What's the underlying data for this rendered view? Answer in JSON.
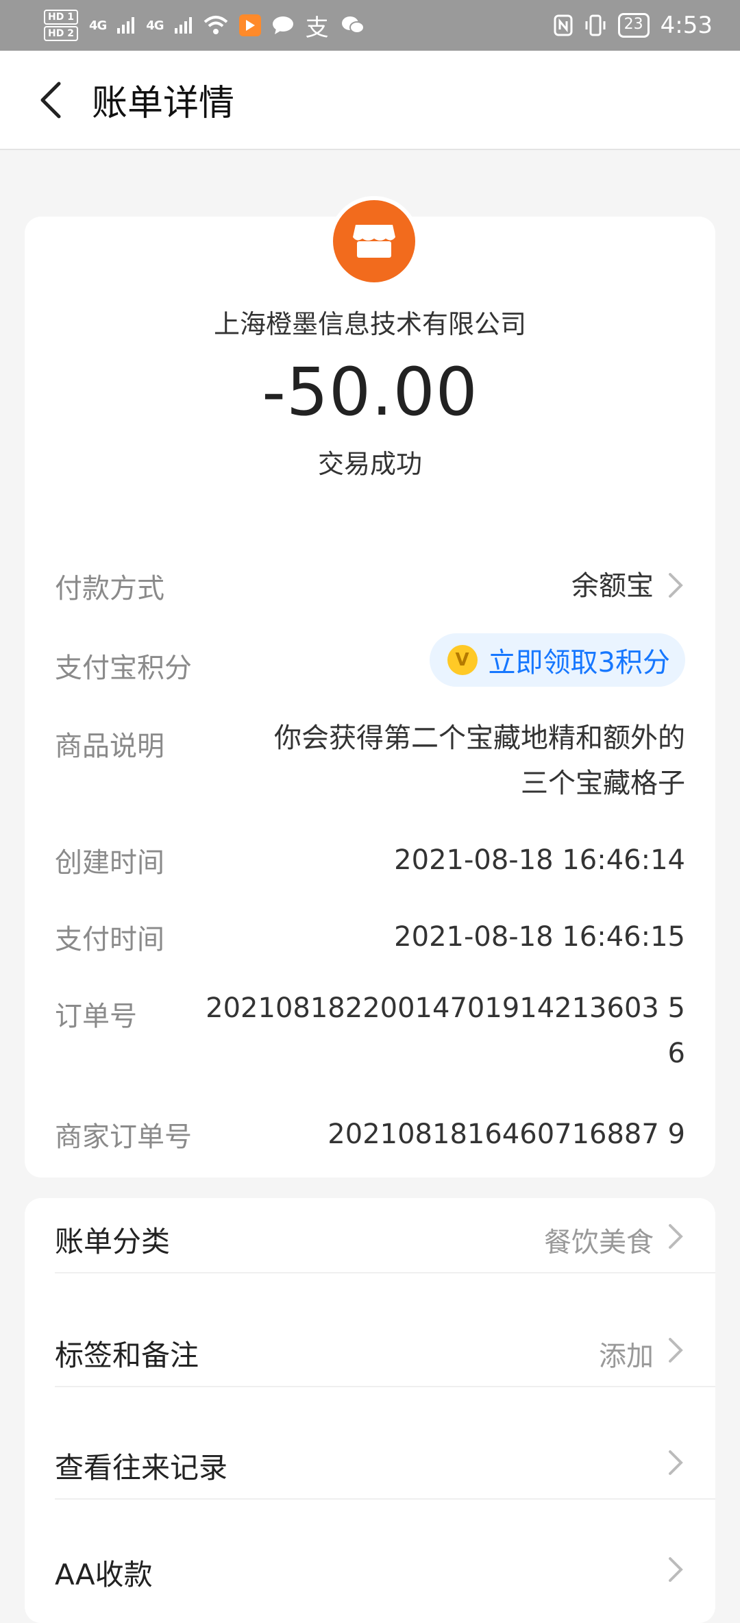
{
  "statusbar": {
    "hd1": "HD 1",
    "hd2": "HD 2",
    "sig1": "4G",
    "sig2": "4G",
    "pay_glyph": "支",
    "battery": "23",
    "time": "4:53"
  },
  "header": {
    "title": "账单详情"
  },
  "bill": {
    "merchant": "上海橙墨信息技术有限公司",
    "amount": "-50.00",
    "status": "交易成功"
  },
  "details": {
    "payment_method_label": "付款方式",
    "payment_method_value": "余额宝",
    "points_label": "支付宝积分",
    "points_value": "立即领取3积分",
    "points_coin": "V",
    "product_label": "商品说明",
    "product_line1": "你会获得第二个宝藏地精和额外的",
    "product_line2": "三个宝藏格子",
    "created_label": "创建时间",
    "created_value": "2021-08-18 16:46:14",
    "paid_label": "支付时间",
    "paid_value": "2021-08-18 16:46:15",
    "order_label": "订单号",
    "order_line1": "20210818220014701914213603 5",
    "order_line2": "6",
    "merchant_order_label": "商家订单号",
    "merchant_order_value": "2021081816460716887 9"
  },
  "menu": {
    "category_label": "账单分类",
    "category_value": "餐饮美食",
    "tags_label": "标签和备注",
    "tags_value": "添加",
    "history_label": "查看往来记录",
    "aa_label": "AA收款"
  },
  "colors": {
    "merchant_logo": "#f26b1d",
    "link_blue": "#1677ff",
    "statusbar": "#9a9a9a"
  }
}
